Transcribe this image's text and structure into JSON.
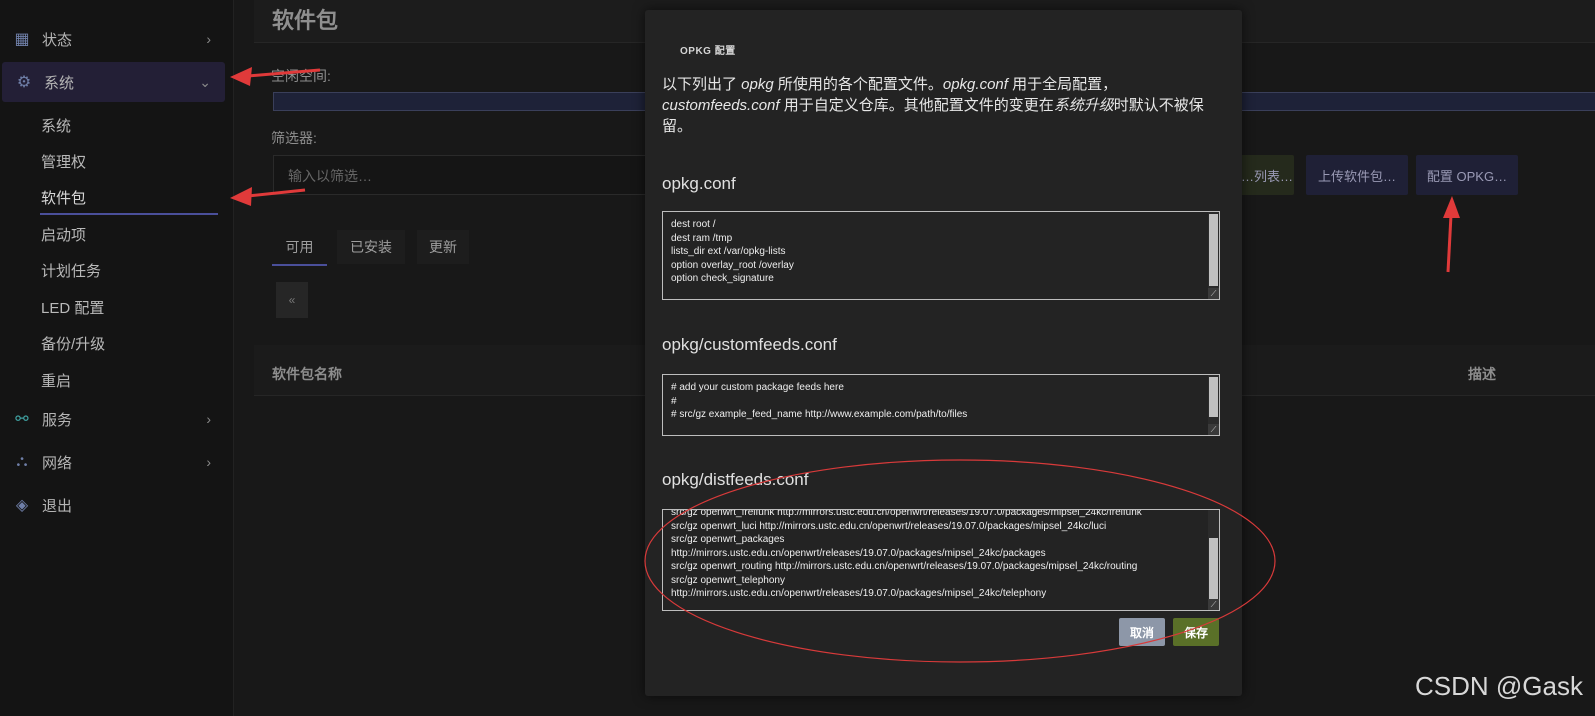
{
  "sidebar": {
    "menu": [
      {
        "label": "状态",
        "icon": "dashboard-icon"
      },
      {
        "label": "系统",
        "icon": "gear-icon"
      },
      {
        "label": "服务",
        "icon": "services-icon"
      },
      {
        "label": "网络",
        "icon": "network-icon"
      },
      {
        "label": "退出",
        "icon": "logout-icon"
      }
    ],
    "system_sub": [
      "系统",
      "管理权",
      "软件包",
      "启动项",
      "计划任务",
      "LED 配置",
      "备份/升级",
      "重启"
    ]
  },
  "page": {
    "title": "软件包",
    "free_space_label": "空闲空间:",
    "filter_label": "筛选器:",
    "filter_placeholder": "输入以筛选…",
    "buttons": [
      "…列表…",
      "上传软件包…",
      "配置 OPKG…"
    ],
    "tabs": [
      "可用",
      "已安装",
      "更新"
    ],
    "pager_prev": "«",
    "table_headers": {
      "name": "软件包名称",
      "desc": "描述"
    }
  },
  "modal": {
    "title": "OPKG 配置",
    "desc": {
      "p1": "以下列出了 ",
      "em1": "opkg",
      "p2": " 所使用的各个配置文件。",
      "em2": "opkg.conf",
      "p3": " 用于全局配置，",
      "em3": "customfeeds.conf",
      "p4": " 用于自定义仓库。其他配置文件的变更在",
      "em4": "系统升级",
      "p5": "时默认不被保留。"
    },
    "sections": [
      {
        "title": "opkg.conf",
        "content": "dest root /\ndest ram /tmp\nlists_dir ext /var/opkg-lists\noption overlay_root /overlay\noption check_signature"
      },
      {
        "title": "opkg/customfeeds.conf",
        "content": "# add your custom package feeds here\n#\n# src/gz example_feed_name http://www.example.com/path/to/files"
      },
      {
        "title": "opkg/distfeeds.conf",
        "content": "src/gz openwrt_freifunk http://mirrors.ustc.edu.cn/openwrt/releases/19.07.0/packages/mipsel_24kc/freifunk\nsrc/gz openwrt_luci http://mirrors.ustc.edu.cn/openwrt/releases/19.07.0/packages/mipsel_24kc/luci\nsrc/gz openwrt_packages\nhttp://mirrors.ustc.edu.cn/openwrt/releases/19.07.0/packages/mipsel_24kc/packages\nsrc/gz openwrt_routing http://mirrors.ustc.edu.cn/openwrt/releases/19.07.0/packages/mipsel_24kc/routing\nsrc/gz openwrt_telephony\nhttp://mirrors.ustc.edu.cn/openwrt/releases/19.07.0/packages/mipsel_24kc/telephony"
      }
    ],
    "cancel_label": "取消",
    "save_label": "保存"
  },
  "watermark": "CSDN @Gask",
  "colors": {
    "accent": "#4a4f9a",
    "save": "#5a7028",
    "cancel": "#8d97a8",
    "annotation": "#e03a3a"
  }
}
